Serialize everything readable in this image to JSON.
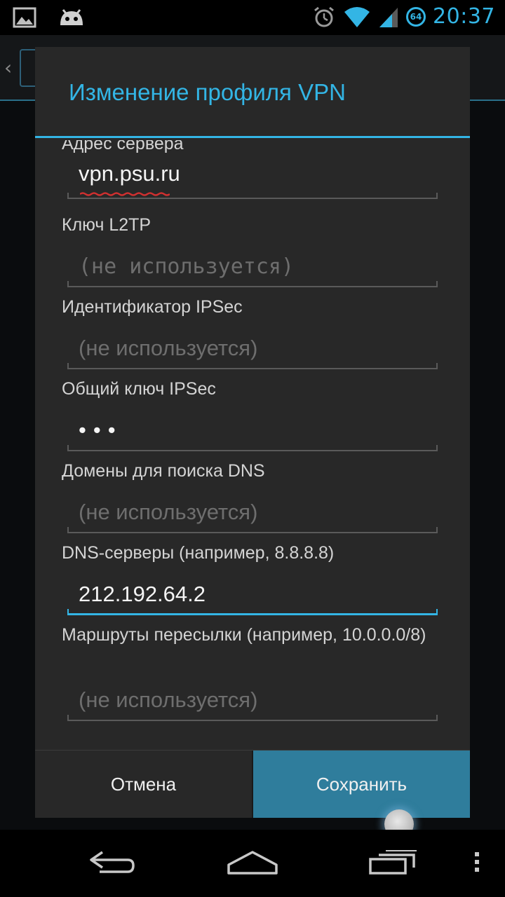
{
  "status_bar": {
    "time": "20:37",
    "badge": "64",
    "icons": [
      "image-icon",
      "android-robot-icon",
      "alarm-icon",
      "wifi-icon",
      "signal-icon",
      "badge-64-icon"
    ]
  },
  "dialog": {
    "title": "Изменение профиля VPN",
    "fields": [
      {
        "label": "Адрес сервера",
        "value": "vpn.psu.ru",
        "placeholder": ""
      },
      {
        "label": "Ключ L2TP",
        "value": "",
        "placeholder": "(не используется)"
      },
      {
        "label": "Идентификатор IPSec",
        "value": "",
        "placeholder": "(не используется)"
      },
      {
        "label": "Общий ключ IPSec",
        "value": "•••",
        "placeholder": ""
      },
      {
        "label": "Домены для поиска DNS",
        "value": "",
        "placeholder": "(не используется)"
      },
      {
        "label": "DNS-серверы (например, 8.8.8.8)",
        "value": "212.192.64.2",
        "placeholder": ""
      },
      {
        "label": "Маршруты пересылки (например, 10.0.0.0/8)",
        "value": "",
        "placeholder": "(не используется)"
      }
    ],
    "buttons": {
      "cancel": "Отмена",
      "save": "Сохранить"
    }
  },
  "nav_bar": {
    "icons": [
      "back-icon",
      "home-icon",
      "recents-icon",
      "menu-icon"
    ]
  },
  "colors": {
    "accent": "#33b5e5",
    "dialog_bg": "#282828",
    "save_button": "#2f7d9c"
  }
}
